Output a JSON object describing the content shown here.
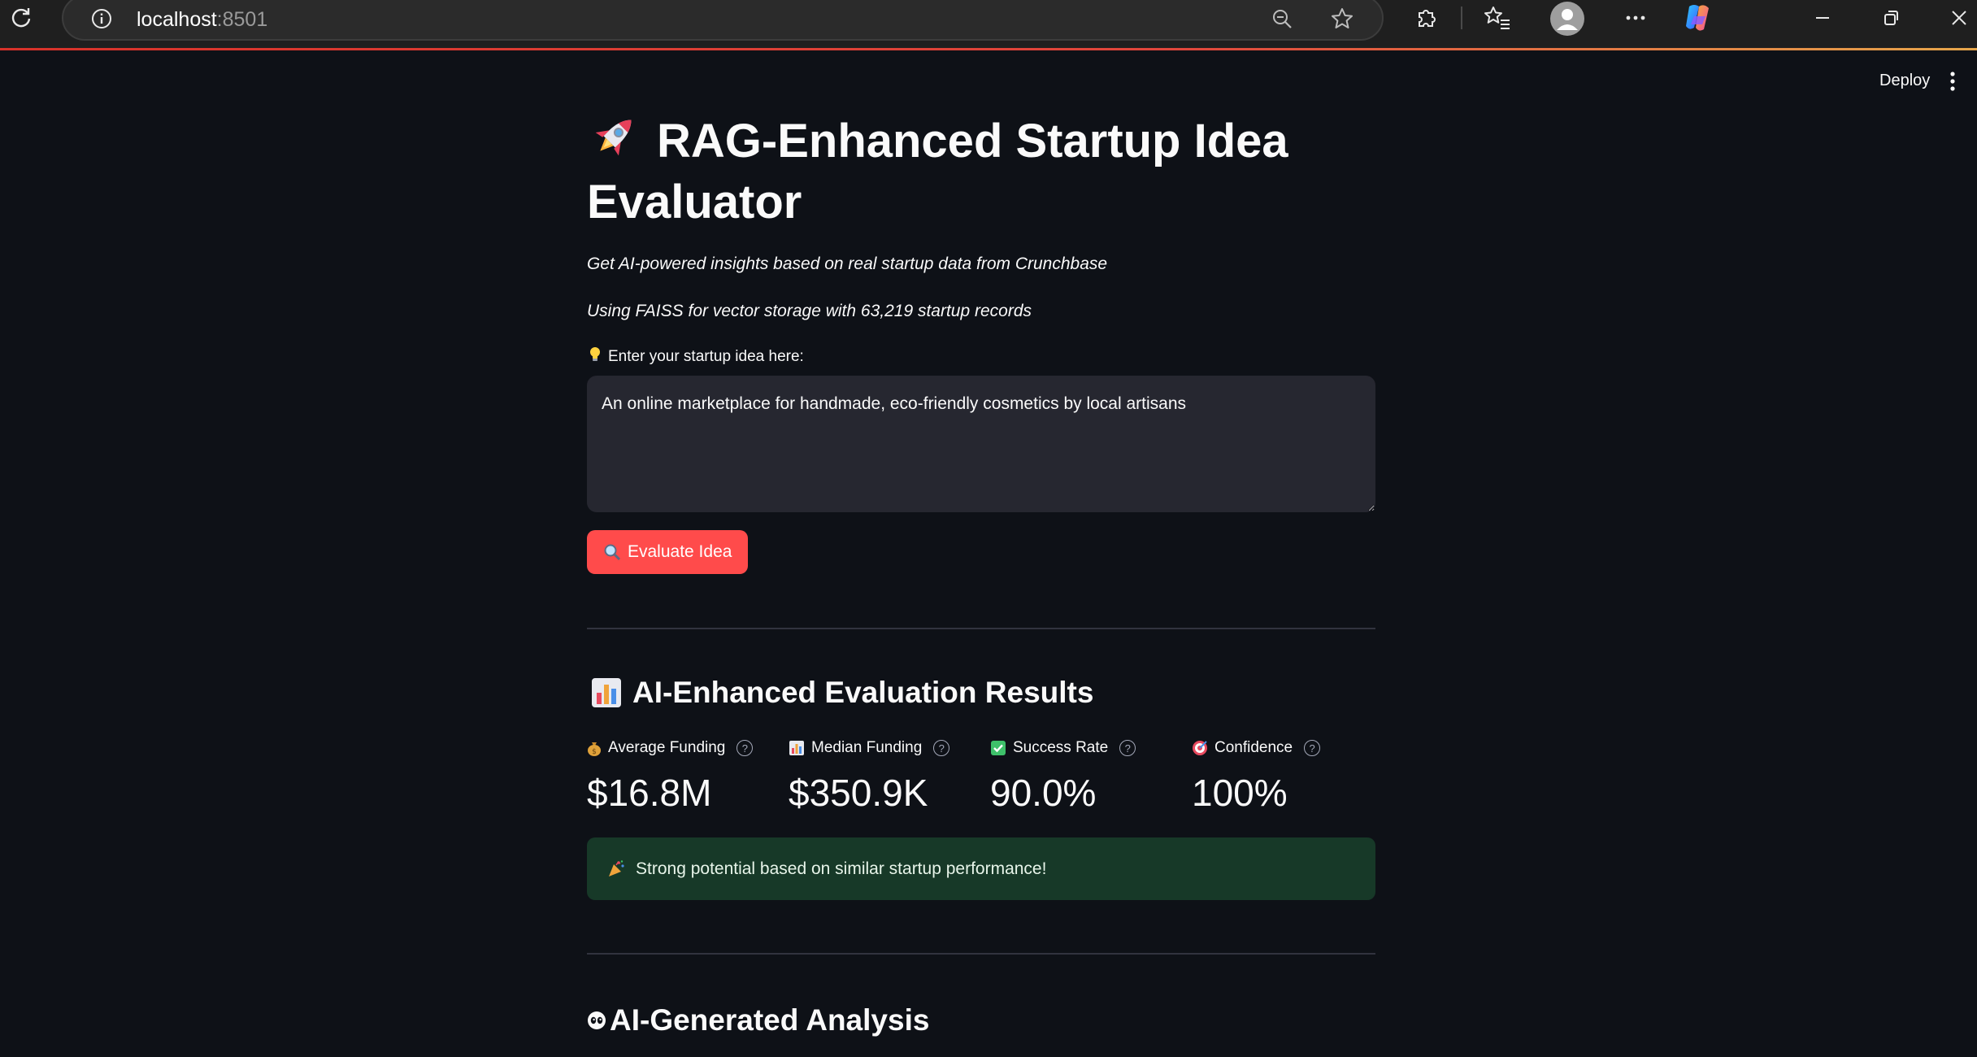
{
  "browser": {
    "url_host": "localhost",
    "url_port": ":8501"
  },
  "header": {
    "deploy_label": "Deploy"
  },
  "app": {
    "title": "RAG-Enhanced Startup Idea Evaluator",
    "title_icon": "rocket-icon",
    "subtitle": "Get AI-powered insights based on real startup data from Crunchbase",
    "storage_note": "Using FAISS for vector storage with 63,219 startup records"
  },
  "input": {
    "label": "Enter your startup idea here:",
    "label_icon": "lightbulb-icon",
    "value": "An online marketplace for handmade, eco-friendly cosmetics by local artisans"
  },
  "actions": {
    "evaluate_label": "Evaluate Idea",
    "evaluate_icon": "magnifier-icon",
    "accent_color": "#ff4b4b"
  },
  "results": {
    "heading": "AI-Enhanced Evaluation Results",
    "heading_icon": "bar-chart-icon",
    "metrics": [
      {
        "label": "Average Funding",
        "value": "$16.8M",
        "icon": "money-bag-icon"
      },
      {
        "label": "Median Funding",
        "value": "$350.9K",
        "icon": "bar-chart-icon"
      },
      {
        "label": "Success Rate",
        "value": "90.0%",
        "icon": "check-box-icon"
      },
      {
        "label": "Confidence",
        "value": "100%",
        "icon": "target-icon"
      }
    ],
    "success_message": "Strong potential based on similar startup performance!",
    "success_icon": "party-popper-icon"
  },
  "analysis": {
    "heading": "AI-Generated Analysis",
    "heading_icon": "eyes-icon"
  }
}
